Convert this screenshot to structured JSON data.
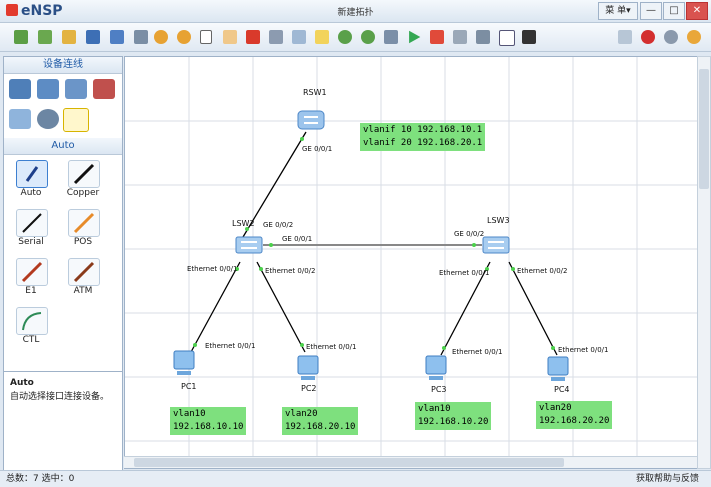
{
  "app": {
    "logo": "eNSP",
    "window_title": "新建拓扑",
    "menu_label": "菜 单▾"
  },
  "window_controls": [
    "—",
    "□",
    "✕"
  ],
  "toolbar": {
    "left_icons": [
      "new-topology-icon",
      "new-example-icon",
      "open-icon",
      "save-icon",
      "save-as-icon",
      "print-icon",
      "undo-icon",
      "redo-icon",
      "select-icon",
      "pan-hand-icon",
      "delete-icon",
      "delete-all-icon",
      "text-note-icon",
      "rectangle-icon",
      "zoom-in-icon",
      "zoom-out-icon",
      "device-table-icon",
      "start-icon",
      "stop-icon",
      "capture-icon",
      "topology-icon",
      "display-grid-icon",
      "screenshot-icon"
    ],
    "right_icons": [
      "forum-icon",
      "huawei-icon",
      "settings-icon",
      "help-icon"
    ]
  },
  "left_panel": {
    "device_header": "设备连线",
    "device_types": [
      "router-icon",
      "switch-icon",
      "wlan-icon",
      "firewall-icon",
      "pc-terminal-icon",
      "cloud-icon",
      "cable-icon"
    ],
    "cable_header": "Auto",
    "cables": [
      {
        "label": "Auto",
        "icon": "auto-cable-icon"
      },
      {
        "label": "Copper",
        "icon": "copper-cable-icon"
      },
      {
        "label": "Serial",
        "icon": "serial-cable-icon"
      },
      {
        "label": "POS",
        "icon": "pos-cable-icon"
      },
      {
        "label": "E1",
        "icon": "e1-cable-icon"
      },
      {
        "label": "ATM",
        "icon": "atm-cable-icon"
      },
      {
        "label": "CTL",
        "icon": "ctl-cable-icon"
      }
    ],
    "description_title": "Auto",
    "description_text": "自动选择接口连接设备。"
  },
  "topology": {
    "devices": [
      {
        "name": "RSW1",
        "type": "router"
      },
      {
        "name": "LSW2",
        "type": "switch"
      },
      {
        "name": "LSW3",
        "type": "switch"
      },
      {
        "name": "PC1",
        "type": "pc"
      },
      {
        "name": "PC2",
        "type": "pc"
      },
      {
        "name": "PC3",
        "type": "pc"
      },
      {
        "name": "PC4",
        "type": "pc"
      }
    ],
    "ports": [
      "GE 0/0/1",
      "GE 0/0/2",
      "GE 0/0/1",
      "GE 0/0/2",
      "Ethernet 0/0/1",
      "Ethernet 0/0/2",
      "Ethernet 0/0/1",
      "Ethernet 0/0/1",
      "Ethernet 0/0/1",
      "Ethernet 0/0/2",
      "Ethernet 0/0/1",
      "Ethernet 0/0/1"
    ],
    "notes": [
      "vlanif 10 192.168.10.1\nvlanif 20 192.168.20.1",
      "vlan10\n192.168.10.10",
      "vlan20\n192.168.20.10",
      "vlan10\n192.168.10.20",
      "vlan20\n192.168.20.20"
    ]
  },
  "status": {
    "summary": "总数：7  选中：0",
    "right_text": "获取帮助与反馈"
  }
}
